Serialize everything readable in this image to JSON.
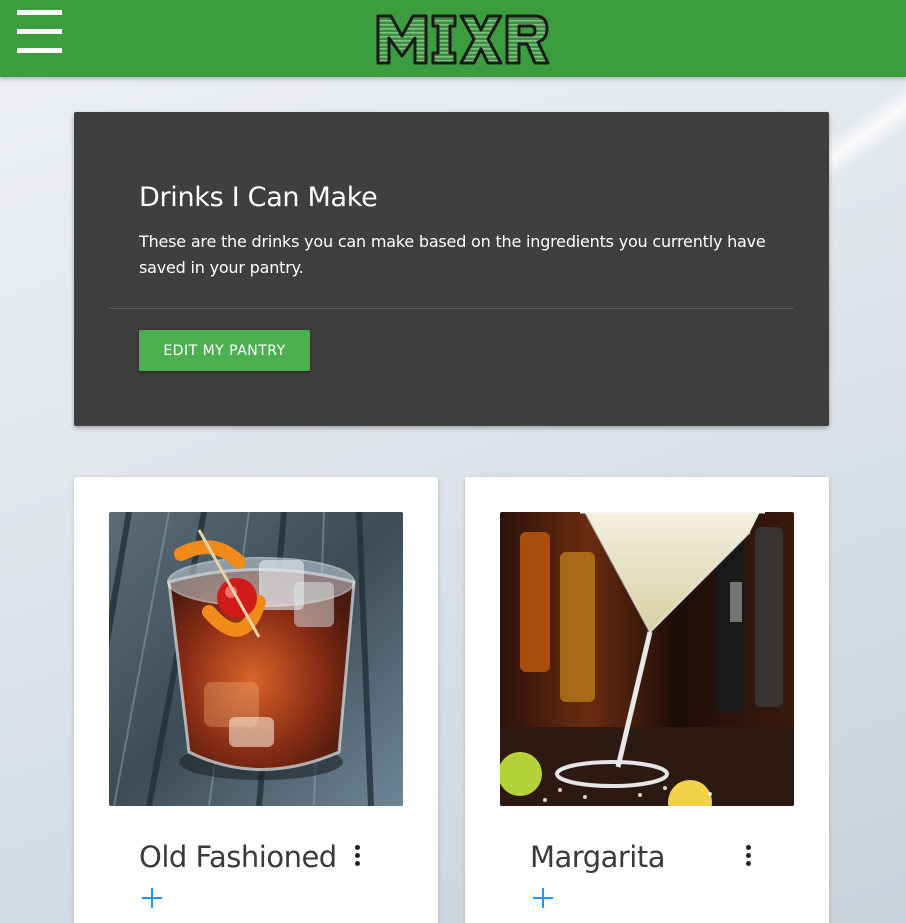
{
  "app": {
    "logo_text": "MIXR",
    "brand_color": "#3b9d3e"
  },
  "header": {
    "menu_icon": "hamburger-menu-icon"
  },
  "hero": {
    "title": "Drinks I Can Make",
    "description": "These are the drinks you can make based on the ingredients you currently have saved in your pantry.",
    "button_label": "EDIT MY PANTRY",
    "button_color": "#4caf50",
    "background": "#3f3f3f"
  },
  "drinks": [
    {
      "name": "Old Fashioned",
      "image_icon": "old-fashioned-photo",
      "menu_icon": "more-vert-icon",
      "add_icon": "plus-icon"
    },
    {
      "name": "Margarita",
      "image_icon": "margarita-photo",
      "menu_icon": "more-vert-icon",
      "add_icon": "plus-icon"
    }
  ]
}
